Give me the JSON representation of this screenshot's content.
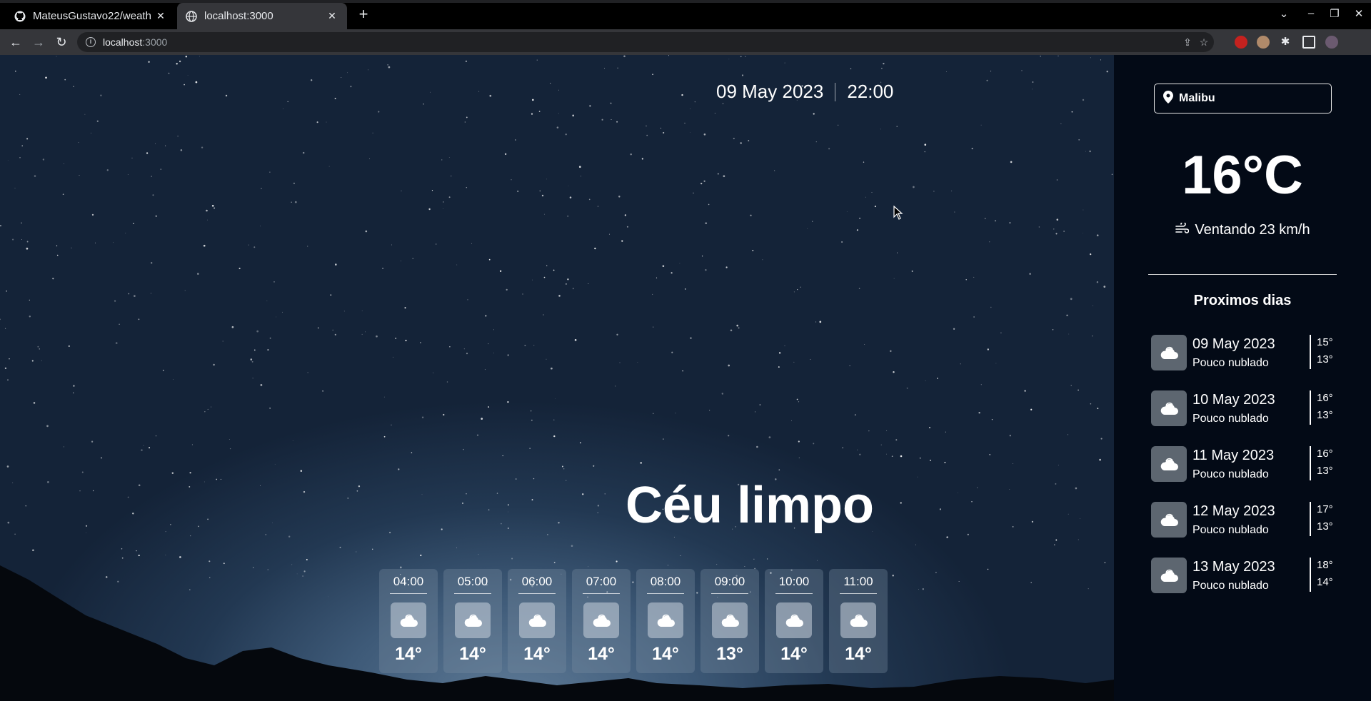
{
  "browser": {
    "tabs": [
      {
        "title": "MateusGustavo22/weath",
        "active": false,
        "icon": "github-icon"
      },
      {
        "title": "localhost:3000",
        "active": true,
        "icon": "globe-icon"
      }
    ],
    "url_host": "localhost",
    "url_port": ":3000"
  },
  "header": {
    "date": "09 May 2023",
    "time": "22:00"
  },
  "current": {
    "condition": "Céu limpo",
    "temperature": "16°C",
    "wind": "Ventando 23 km/h"
  },
  "hourly": [
    {
      "time": "04:00",
      "temp": "14°"
    },
    {
      "time": "05:00",
      "temp": "14°"
    },
    {
      "time": "06:00",
      "temp": "14°"
    },
    {
      "time": "07:00",
      "temp": "14°"
    },
    {
      "time": "08:00",
      "temp": "14°"
    },
    {
      "time": "09:00",
      "temp": "13°"
    },
    {
      "time": "10:00",
      "temp": "14°"
    },
    {
      "time": "11:00",
      "temp": "14°"
    }
  ],
  "sidebar": {
    "search_value": "Malibu",
    "next_days_title": "Proximos dias",
    "days": [
      {
        "date": "09 May 2023",
        "desc": "Pouco nublado",
        "max": "15°",
        "min": "13°"
      },
      {
        "date": "10 May 2023",
        "desc": "Pouco nublado",
        "max": "16°",
        "min": "13°"
      },
      {
        "date": "11 May 2023",
        "desc": "Pouco nublado",
        "max": "16°",
        "min": "13°"
      },
      {
        "date": "12 May 2023",
        "desc": "Pouco nublado",
        "max": "17°",
        "min": "13°"
      },
      {
        "date": "13 May 2023",
        "desc": "Pouco nublado",
        "max": "18°",
        "min": "14°"
      }
    ]
  },
  "colors": {
    "sidebar_bg": "#030a16",
    "accent_text": "#ffffff"
  }
}
